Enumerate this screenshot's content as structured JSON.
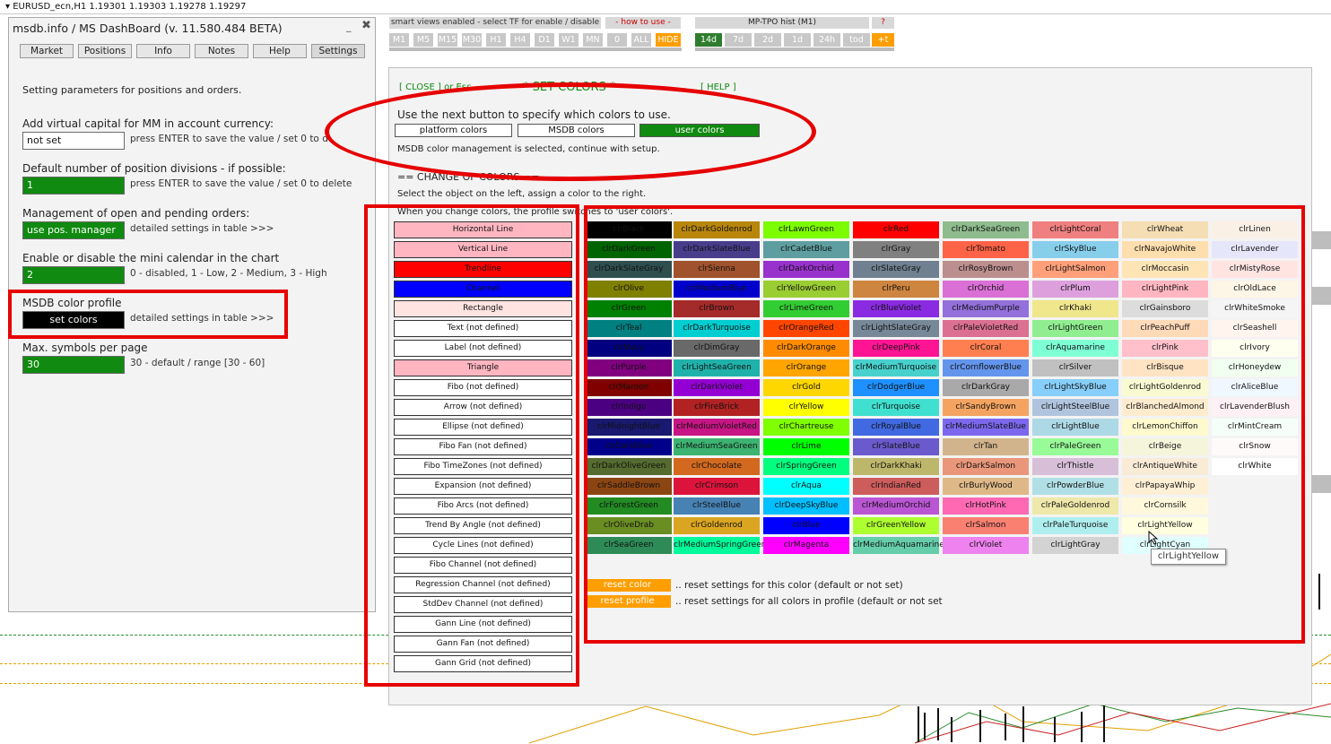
{
  "window": {
    "title_bar": "EURUSD_ecn,H1  1.19301 1.19303 1.19278 1.19297"
  },
  "dashboard": {
    "title": "msdb.info / MS DashBoard (v. 11.580.484 BETA)",
    "minimize": "_",
    "close": "✖",
    "tabs": [
      "Market",
      "Positions",
      "Info",
      "Notes",
      "Help",
      "Settings"
    ],
    "intro": "Setting parameters for positions and orders.",
    "settings": [
      {
        "label": "Add virtual capital for MM in account currency:",
        "value": "not set",
        "hint": "press ENTER to save the value / set 0 to delete"
      },
      {
        "label": "Default number of position divisions - if possible:",
        "value": "1",
        "hint": "press ENTER to save the value / set 0 to delete"
      },
      {
        "label": "Management of open and pending orders:",
        "value": "use pos. manager",
        "hint": "detailed settings in table >>>"
      },
      {
        "label": "Enable or disable the mini calendar in the chart",
        "value": "2",
        "hint": "0 - disabled, 1 - Low, 2 - Medium, 3 - High"
      },
      {
        "label": "MSDB color profile",
        "value": "set colors",
        "hint": "detailed settings in table >>>"
      },
      {
        "label": "Max. symbols per page",
        "value": "30",
        "hint": "30 - default / range [30 - 60]"
      }
    ]
  },
  "toolbar": {
    "smart_views": "smart views enabled - select TF for enable / disable",
    "how_to": "- how to use -",
    "timeframes": [
      "M1",
      "M5",
      "M15",
      "M30",
      "H1",
      "H4",
      "D1",
      "W1",
      "MN",
      "0",
      "ALL",
      "HIDE"
    ],
    "tpo_title": "MP-TPO hist (M1)",
    "tpo_help": "?",
    "tpo_ranges": [
      "14d",
      "7d",
      "2d",
      "1d",
      "24h",
      "tod",
      "+t"
    ]
  },
  "panel": {
    "close": "[ CLOSE ] or Esc",
    "title": "* SET COLORS *",
    "help": "[ HELP ]",
    "instruction": "Use the next button to specify which colors to use.",
    "mode_buttons": [
      "platform colors",
      "MSDB colors",
      "user colors"
    ],
    "status": "MSDB color management is selected, continue with setup.",
    "change_header": "== CHANGE OF COLORS ==",
    "select_hint": "Select the object on the left, assign a color to the right.",
    "profile_note": "When you change colors, the profile switches to 'user colors'.",
    "objects": [
      {
        "label": "Horizontal Line",
        "bg": "#ffb6c1"
      },
      {
        "label": "Vertical Line",
        "bg": "#ffb6c1"
      },
      {
        "label": "Trendline",
        "bg": "#ff0000"
      },
      {
        "label": "Channel",
        "bg": "#0000ff"
      },
      {
        "label": "Rectangle",
        "bg": "#ffe4e1"
      },
      {
        "label": "Text (not defined)",
        "bg": "#ffffff"
      },
      {
        "label": "Label (not defined)",
        "bg": "#ffffff"
      },
      {
        "label": "Triangle",
        "bg": "#ffb6c1"
      },
      {
        "label": "Fibo (not defined)",
        "bg": "#ffffff"
      },
      {
        "label": "Arrow (not defined)",
        "bg": "#ffffff"
      },
      {
        "label": "Ellipse (not defined)",
        "bg": "#ffffff"
      },
      {
        "label": "Fibo Fan (not defined)",
        "bg": "#ffffff"
      },
      {
        "label": "Fibo TimeZones (not defined)",
        "bg": "#ffffff"
      },
      {
        "label": "Expansion (not defined)",
        "bg": "#ffffff"
      },
      {
        "label": "Fibo Arcs (not defined)",
        "bg": "#ffffff"
      },
      {
        "label": "Trend By Angle (not defined)",
        "bg": "#ffffff"
      },
      {
        "label": "Cycle Lines (not defined)",
        "bg": "#ffffff"
      },
      {
        "label": "Fibo Channel (not defined)",
        "bg": "#ffffff"
      },
      {
        "label": "Regression Channel (not defined)",
        "bg": "#ffffff"
      },
      {
        "label": "StdDev Channel (not defined)",
        "bg": "#ffffff"
      },
      {
        "label": "Gann Line (not defined)",
        "bg": "#ffffff"
      },
      {
        "label": "Gann Fan (not defined)",
        "bg": "#ffffff"
      },
      {
        "label": "Gann Grid (not defined)",
        "bg": "#ffffff"
      }
    ],
    "color_columns": [
      [
        [
          "clrBlack",
          "#000000"
        ],
        [
          "clrDarkGreen",
          "#006400"
        ],
        [
          "clrDarkSlateGray",
          "#2f4f4f"
        ],
        [
          "clrOlive",
          "#808000"
        ],
        [
          "clrGreen",
          "#008000"
        ],
        [
          "clrTeal",
          "#008080"
        ],
        [
          "clrNavy",
          "#000080"
        ],
        [
          "clrPurple",
          "#800080"
        ],
        [
          "clrMaroon",
          "#800000"
        ],
        [
          "clrIndigo",
          "#4b0082"
        ],
        [
          "clrMidnightBlue",
          "#191970"
        ],
        [
          "clrDarkBlue",
          "#00008b"
        ],
        [
          "clrDarkOliveGreen",
          "#556b2f"
        ],
        [
          "clrSaddleBrown",
          "#8b4513"
        ],
        [
          "clrForestGreen",
          "#228b22"
        ],
        [
          "clrOliveDrab",
          "#6b8e23"
        ],
        [
          "clrSeaGreen",
          "#2e8b57"
        ]
      ],
      [
        [
          "clrDarkGoldenrod",
          "#b8860b"
        ],
        [
          "clrDarkSlateBlue",
          "#483d8b"
        ],
        [
          "clrSienna",
          "#a0522d"
        ],
        [
          "clrMediumBlue",
          "#0000cd"
        ],
        [
          "clrBrown",
          "#a52a2a"
        ],
        [
          "clrDarkTurquoise",
          "#00ced1"
        ],
        [
          "clrDimGray",
          "#696969"
        ],
        [
          "clrLightSeaGreen",
          "#20b2aa"
        ],
        [
          "clrDarkViolet",
          "#9400d3"
        ],
        [
          "clrFireBrick",
          "#b22222"
        ],
        [
          "clrMediumVioletRed",
          "#c71585"
        ],
        [
          "clrMediumSeaGreen",
          "#3cb371"
        ],
        [
          "clrChocolate",
          "#d2691e"
        ],
        [
          "clrCrimson",
          "#dc143c"
        ],
        [
          "clrSteelBlue",
          "#4682b4"
        ],
        [
          "clrGoldenrod",
          "#daa520"
        ],
        [
          "clrMediumSpringGreen",
          "#00fa9a"
        ]
      ],
      [
        [
          "clrLawnGreen",
          "#7cfc00"
        ],
        [
          "clrCadetBlue",
          "#5f9ea0"
        ],
        [
          "clrDarkOrchid",
          "#9932cc"
        ],
        [
          "clrYellowGreen",
          "#9acd32"
        ],
        [
          "clrLimeGreen",
          "#32cd32"
        ],
        [
          "clrOrangeRed",
          "#ff4500"
        ],
        [
          "clrDarkOrange",
          "#ff8c00"
        ],
        [
          "clrOrange",
          "#ffa500"
        ],
        [
          "clrGold",
          "#ffd700"
        ],
        [
          "clrYellow",
          "#ffff00"
        ],
        [
          "clrChartreuse",
          "#7fff00"
        ],
        [
          "clrLime",
          "#00ff00"
        ],
        [
          "clrSpringGreen",
          "#00ff7f"
        ],
        [
          "clrAqua",
          "#00ffff"
        ],
        [
          "clrDeepSkyBlue",
          "#00bfff"
        ],
        [
          "clrBlue",
          "#0000ff"
        ],
        [
          "clrMagenta",
          "#ff00ff"
        ]
      ],
      [
        [
          "clrRed",
          "#ff0000"
        ],
        [
          "clrGray",
          "#808080"
        ],
        [
          "clrSlateGray",
          "#708090"
        ],
        [
          "clrPeru",
          "#cd853f"
        ],
        [
          "clrBlueViolet",
          "#8a2be2"
        ],
        [
          "clrLightSlateGray",
          "#778899"
        ],
        [
          "clrDeepPink",
          "#ff1493"
        ],
        [
          "clrMediumTurquoise",
          "#48d1cc"
        ],
        [
          "clrDodgerBlue",
          "#1e90ff"
        ],
        [
          "clrTurquoise",
          "#40e0d0"
        ],
        [
          "clrRoyalBlue",
          "#4169e1"
        ],
        [
          "clrSlateBlue",
          "#6a5acd"
        ],
        [
          "clrDarkKhaki",
          "#bdb76b"
        ],
        [
          "clrIndianRed",
          "#cd5c5c"
        ],
        [
          "clrMediumOrchid",
          "#ba55d3"
        ],
        [
          "clrGreenYellow",
          "#adff2f"
        ],
        [
          "clrMediumAquamarine",
          "#66cdaa"
        ]
      ],
      [
        [
          "clrDarkSeaGreen",
          "#8fbc8f"
        ],
        [
          "clrTomato",
          "#ff6347"
        ],
        [
          "clrRosyBrown",
          "#bc8f8f"
        ],
        [
          "clrOrchid",
          "#da70d6"
        ],
        [
          "clrMediumPurple",
          "#9370db"
        ],
        [
          "clrPaleVioletRed",
          "#db7093"
        ],
        [
          "clrCoral",
          "#ff7f50"
        ],
        [
          "clrCornflowerBlue",
          "#6495ed"
        ],
        [
          "clrDarkGray",
          "#a9a9a9"
        ],
        [
          "clrSandyBrown",
          "#f4a460"
        ],
        [
          "clrMediumSlateBlue",
          "#7b68ee"
        ],
        [
          "clrTan",
          "#d2b48c"
        ],
        [
          "clrDarkSalmon",
          "#e9967a"
        ],
        [
          "clrBurlyWood",
          "#deb887"
        ],
        [
          "clrHotPink",
          "#ff69b4"
        ],
        [
          "clrSalmon",
          "#fa8072"
        ],
        [
          "clrViolet",
          "#ee82ee"
        ]
      ],
      [
        [
          "clrLightCoral",
          "#f08080"
        ],
        [
          "clrSkyBlue",
          "#87ceeb"
        ],
        [
          "clrLightSalmon",
          "#ffa07a"
        ],
        [
          "clrPlum",
          "#dda0dd"
        ],
        [
          "clrKhaki",
          "#f0e68c"
        ],
        [
          "clrLightGreen",
          "#90ee90"
        ],
        [
          "clrAquamarine",
          "#7fffd4"
        ],
        [
          "clrSilver",
          "#c0c0c0"
        ],
        [
          "clrLightSkyBlue",
          "#87cefa"
        ],
        [
          "clrLightSteelBlue",
          "#b0c4de"
        ],
        [
          "clrLightBlue",
          "#add8e6"
        ],
        [
          "clrPaleGreen",
          "#98fb98"
        ],
        [
          "clrThistle",
          "#d8bfd8"
        ],
        [
          "clrPowderBlue",
          "#b0e0e6"
        ],
        [
          "clrPaleGoldenrod",
          "#eee8aa"
        ],
        [
          "clrPaleTurquoise",
          "#afeeee"
        ],
        [
          "clrLightGray",
          "#d3d3d3"
        ]
      ],
      [
        [
          "clrWheat",
          "#f5deb3"
        ],
        [
          "clrNavajoWhite",
          "#ffdead"
        ],
        [
          "clrMoccasin",
          "#ffe4b5"
        ],
        [
          "clrLightPink",
          "#ffb6c1"
        ],
        [
          "clrGainsboro",
          "#dcdcdc"
        ],
        [
          "clrPeachPuff",
          "#ffdab9"
        ],
        [
          "clrPink",
          "#ffc0cb"
        ],
        [
          "clrBisque",
          "#ffe4c4"
        ],
        [
          "clrLightGoldenrod",
          "#fafad2"
        ],
        [
          "clrBlanchedAlmond",
          "#ffebcd"
        ],
        [
          "clrLemonChiffon",
          "#fffacd"
        ],
        [
          "clrBeige",
          "#f5f5dc"
        ],
        [
          "clrAntiqueWhite",
          "#faebd7"
        ],
        [
          "clrPapayaWhip",
          "#ffefd5"
        ],
        [
          "clrCornsilk",
          "#fff8dc"
        ],
        [
          "clrLightYellow",
          "#ffffe0"
        ],
        [
          "clrLightCyan",
          "#e0ffff"
        ]
      ],
      [
        [
          "clrLinen",
          "#faf0e6"
        ],
        [
          "clrLavender",
          "#e6e6fa"
        ],
        [
          "clrMistyRose",
          "#ffe4e1"
        ],
        [
          "clrOldLace",
          "#fdf5e6"
        ],
        [
          "clrWhiteSmoke",
          "#f5f5f5"
        ],
        [
          "clrSeashell",
          "#fff5ee"
        ],
        [
          "clrIvory",
          "#fffff0"
        ],
        [
          "clrHoneydew",
          "#f0fff0"
        ],
        [
          "clrAliceBlue",
          "#f0f8ff"
        ],
        [
          "clrLavenderBlush",
          "#fff0f5"
        ],
        [
          "clrMintCream",
          "#f5fffa"
        ],
        [
          "clrSnow",
          "#fffafa"
        ],
        [
          "clrWhite",
          "#ffffff"
        ]
      ]
    ],
    "reset_color": "reset color",
    "reset_color_desc": ".. reset settings for this color (default or not set)",
    "reset_profile": "reset profile",
    "reset_profile_desc": ".. reset settings for all colors in profile (default or not set",
    "tooltip": "clrLightYellow"
  },
  "colors": {
    "accent_green": "#108a10",
    "annotation_red": "#e60000",
    "orange": "#ff9e00"
  }
}
